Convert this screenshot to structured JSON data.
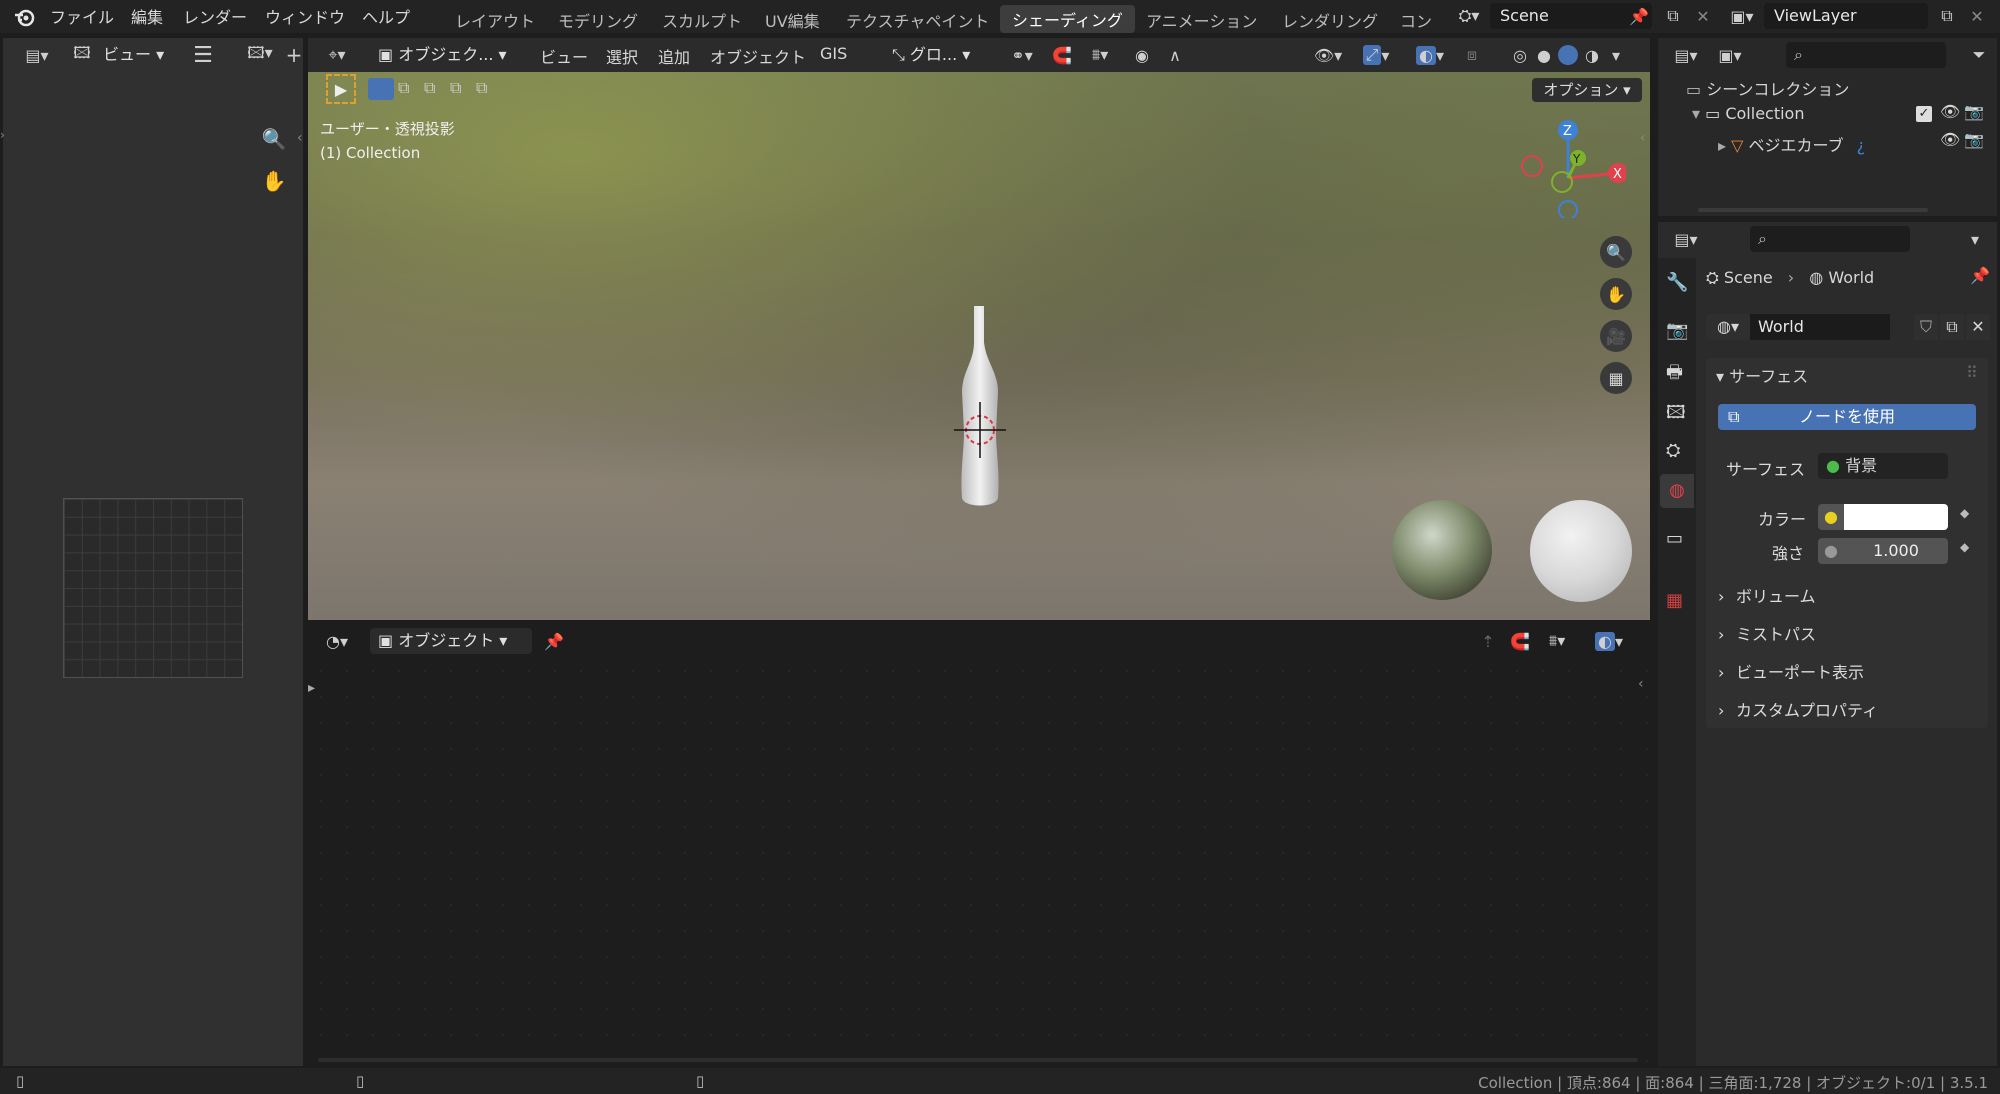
{
  "topbar": {
    "menus": [
      "ファイル",
      "編集",
      "レンダー",
      "ウィンドウ",
      "ヘルプ"
    ],
    "workspace_tabs": [
      "レイアウト",
      "モデリング",
      "スカルプト",
      "UV編集",
      "テクスチャペイント",
      "シェーディング",
      "アニメーション",
      "レンダリング",
      "コン"
    ],
    "active_tab": "シェーディング",
    "scene_name": "Scene",
    "view_layer": "ViewLayer"
  },
  "left_panel": {
    "view_label": "ビュー"
  },
  "viewport": {
    "header": {
      "mode": "オブジェク...",
      "menus": [
        "ビュー",
        "選択",
        "追加",
        "オブジェクト",
        "GIS"
      ],
      "transform_orientation": "グロ...",
      "options_label": "オプション"
    },
    "overlay_title": "ユーザー・透視投影",
    "overlay_collection": "(1) Collection",
    "gizmo": {
      "z": "Z",
      "y": "Y",
      "x": "X"
    }
  },
  "node_editor": {
    "header": {
      "mode": "オブジェクト"
    }
  },
  "outliner": {
    "scene_collection": "シーンコレクション",
    "collection": "Collection",
    "object": "ベジエカーブ"
  },
  "properties": {
    "breadcrumb_scene": "Scene",
    "breadcrumb_world": "World",
    "world_name": "World",
    "surface_panel": "サーフェス",
    "use_nodes_button": "ノードを使用",
    "surface_label": "サーフェス",
    "surface_value": "背景",
    "color_label": "カラー",
    "color_value": "#ffffff",
    "strength_label": "強さ",
    "strength_value": "1.000",
    "collapsed_panels": [
      "ボリューム",
      "ミストパス",
      "ビューポート表示",
      "カスタムプロパティ"
    ]
  },
  "statusbar": {
    "text": "Collection | 頂点:864 | 面:864 | 三角面:1,728 | オブジェクト:0/1 | 3.5.1"
  },
  "colors": {
    "accent_blue": "#4772b3",
    "active_tab_bg": "#3d3d3d",
    "gizmo_x": "#e0414c",
    "gizmo_y": "#7fb22b",
    "gizmo_z": "#3d82d6"
  }
}
